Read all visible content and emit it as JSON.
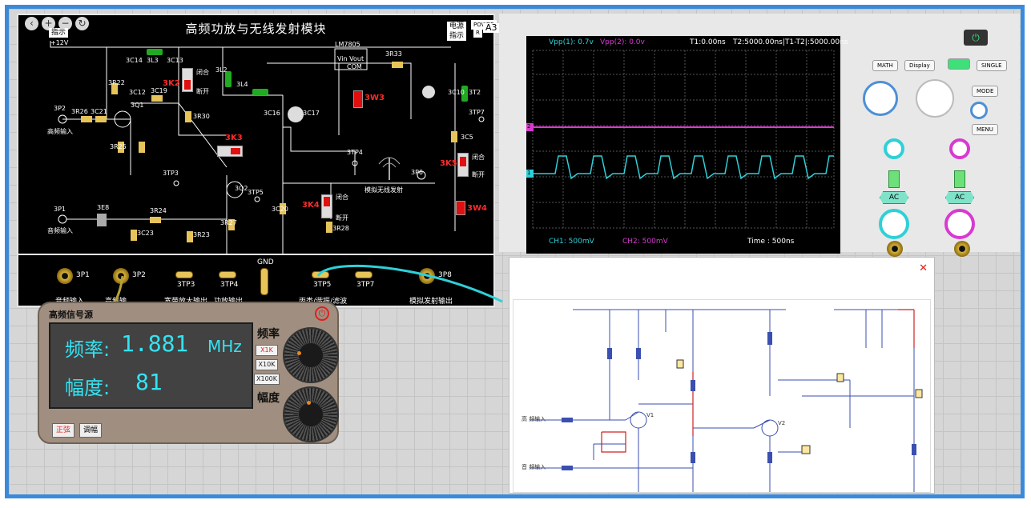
{
  "board": {
    "title": "高频功放与无线发射模块",
    "power_tag_left": "+12V",
    "indicator_left": "指示",
    "power_tag_right": "电源",
    "indicator_right": "指示",
    "power_label": "POWER",
    "power_r": "R",
    "module_code": "A3",
    "labels": {
      "lm7805": "LM7805",
      "vin_vout": "Vin Vout",
      "com": "COM",
      "r3r33": "3R33",
      "c3c14": "3C14",
      "l3l3": "3L3",
      "c3c13": "3C13",
      "r3r22": "3R22",
      "c3c21": "3C21",
      "r3r26": "3R26",
      "q3q1": "3Q1",
      "c3c12": "3C12",
      "c3c19": "3C19",
      "r3r25": "3R25",
      "r3r30": "3R30",
      "l3l4": "3L4",
      "c3c16": "3C16",
      "c3c17": "3C17",
      "l3l2": "3L2",
      "t3t2": "3T2",
      "c3c10": "3C10",
      "c3c5": "3C5",
      "tp3tp7": "3TP7",
      "tp3tp4": "3TP4",
      "tp3tp3": "3TP3",
      "q3q2": "3Q2",
      "tp3tp5": "3TP5",
      "r3r24": "3R24",
      "r3r23": "3R23",
      "c3c23": "3C23",
      "e3e8": "3E8",
      "c3c20": "3C20",
      "r3r28": "3R28",
      "r3r27": "3R27",
      "p3p2": "3P2",
      "p3p1": "3P1",
      "p3p6": "3P6",
      "hf_input": "高频输入",
      "audio_input": "音频输入",
      "wireless_tx": "模拟无线发射",
      "closed_a": "闭合",
      "open_a": "断开",
      "closed_b": "闭合",
      "open_b": "断开",
      "closed_c": "闭合",
      "open_c": "断开",
      "closed_d": "闭合",
      "open_d": "断开"
    },
    "switches": {
      "k2": "3K2",
      "k3": "3K3",
      "w3": "3W3",
      "k4": "3K4",
      "k5": "3K5",
      "w4": "3W4"
    }
  },
  "strip": {
    "p1": "3P1",
    "p2": "3P2",
    "tp3": "3TP3",
    "tp4": "3TP4",
    "gnd": "GND",
    "tp5": "3TP5",
    "tp7": "3TP7",
    "p8": "3P8",
    "out1": "音频输入",
    "out2": "高频输",
    "out3": "宽带放大输出",
    "out4": "功放输出",
    "out5": "丙类/谐振/滤波",
    "out6": "模拟发射输出"
  },
  "generator": {
    "title": "高频信号源",
    "freq_label": "频率:",
    "freq_value": "1.881",
    "freq_unit": "MHz",
    "amp_label": "幅度:",
    "amp_value": "81",
    "freq_knob_label": "频率",
    "amp_knob_label": "幅度",
    "x1k": "X1K",
    "x10k": "X10K",
    "x100k": "X100K",
    "sine_btn": "正弦",
    "am_btn": "调幅"
  },
  "scope": {
    "vpp1": "Vpp(1): 0.7v",
    "vpp2": "Vpp(2): 0.0v",
    "t1": "T1:0.00ns",
    "t2": "T2:5000.00ns|T1-T2|:5000.00ns",
    "ch1": "CH1: 500mV",
    "ch2": "CH2: 500mV",
    "time": "Time : 500ns",
    "marker1": "1",
    "marker2": "2",
    "btn_math": "MATH",
    "btn_display": "Display",
    "btn_single": "SINGLE",
    "btn_mode": "MODE",
    "btn_menu": "MENU",
    "ac1": "AC",
    "ac2": "AC",
    "power_icon": "power-icon",
    "ch1_color": "#2fd0d8",
    "ch2_color": "#d83ad0"
  },
  "schematic": {
    "close": "✕",
    "hf_in": "高 频输入",
    "audio_in": "音 频输入",
    "v1": "V1",
    "v2": "V2"
  }
}
